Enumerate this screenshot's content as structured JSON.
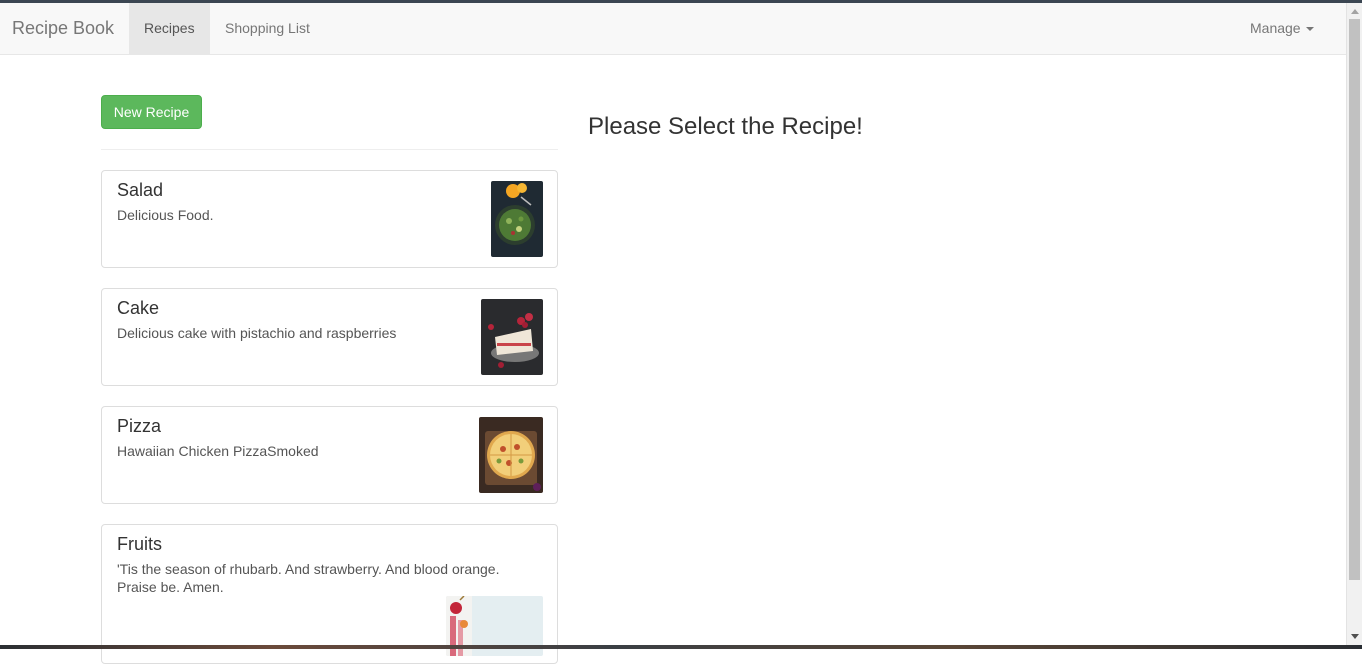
{
  "navbar": {
    "brand": "Recipe Book",
    "items": [
      {
        "label": "Recipes",
        "active": true
      },
      {
        "label": "Shopping List",
        "active": false
      }
    ],
    "manage_label": "Manage"
  },
  "list": {
    "new_button_label": "New Recipe",
    "recipes": [
      {
        "name": "Salad",
        "description": "Delicious Food.",
        "image": "salad-bowl-photo"
      },
      {
        "name": "Cake",
        "description": "Delicious cake with pistachio and raspberries",
        "image": "cake-slice-photo"
      },
      {
        "name": "Pizza",
        "description": "Hawaiian Chicken PizzaSmoked",
        "image": "pizza-photo"
      },
      {
        "name": "Fruits",
        "description": "'Tis the season of rhubarb. And strawberry. And blood orange. Praise be. Amen.",
        "image": "fruits-photo"
      }
    ]
  },
  "detail": {
    "placeholder": "Please Select the Recipe!"
  },
  "colors": {
    "accent_green": "#5cb85c",
    "navbar_bg": "#f8f8f8"
  }
}
